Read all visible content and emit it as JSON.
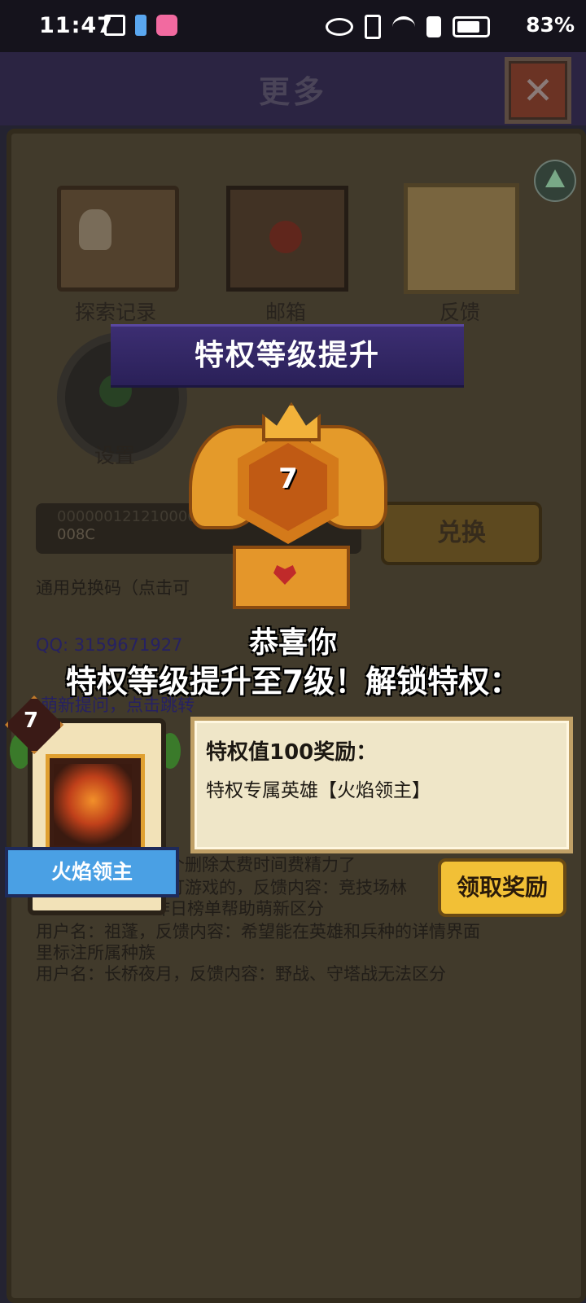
{
  "status_bar": {
    "time": "11:47",
    "battery_percent": "83%"
  },
  "header": {
    "title": "更多",
    "close_icon": "close-icon"
  },
  "menu": {
    "items": [
      {
        "label": "探索记录",
        "icon": "skull-book-icon"
      },
      {
        "label": "邮箱",
        "icon": "mailbox-icon"
      },
      {
        "label": "反馈",
        "icon": "scroll-paper-icon"
      },
      {
        "label": "设置",
        "icon": "gear-icon"
      }
    ]
  },
  "redeem": {
    "code_line1": "00000012121000002",
    "code_line2": "008C",
    "button_label": "兑换",
    "hint": "通用兑换码（点击可"
  },
  "background_text": {
    "qq": "QQ: 3159671927",
    "link": "萌新提问，点击跳转",
    "feedback_lines": [
      "个删除太费时间费精力了",
      "打游戏的，反馈内容：竞技场林",
      "昨日榜单帮助萌新区分",
      "用户名：祖蓬，反馈内容：希望能在英雄和兵种的详情界面",
      "里标注所属种族",
      "用户名：长桥夜月，反馈内容：野战、守塔战无法区分"
    ]
  },
  "popup": {
    "banner_title": "特权等级提升",
    "emblem_level": "7",
    "congrats": "恭喜你",
    "unlock_text": "特权等级提升至7级！解锁特权：",
    "hero": {
      "level": "7",
      "name": "火焰领主"
    },
    "reward": {
      "title": "特权值100奖励：",
      "description": "特权专属英雄【火焰领主】"
    },
    "claim_button": "领取奖励"
  },
  "colors": {
    "banner": "#3c2e72",
    "claim_button": "#f2c036",
    "hero_ribbon": "#4aa0e4"
  }
}
